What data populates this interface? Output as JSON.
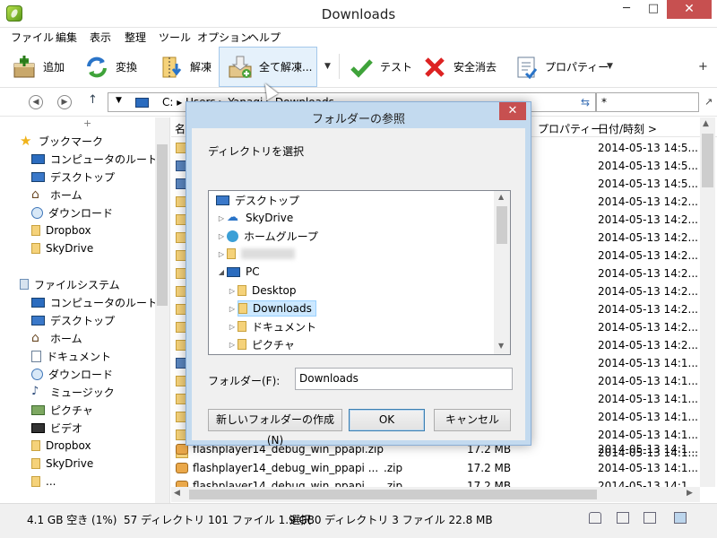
{
  "window": {
    "title": "Downloads",
    "minimize": "─",
    "maximize": "□",
    "close": "✕"
  },
  "menu": [
    "ファイル",
    "編集",
    "表示",
    "整理",
    "ツール",
    "オプション",
    "ヘルプ"
  ],
  "toolbar": {
    "add": "追加",
    "convert": "変換",
    "extract": "解凍",
    "extract_all": "全て解凍...",
    "test": "テスト",
    "secure_delete": "安全消去",
    "properties": "プロパティー"
  },
  "address": {
    "path": "C: ▸ Users ▸ Yanagi ▸ Downloads",
    "filter": "*"
  },
  "tree": {
    "bookmarks_title": "ブックマーク",
    "bookmarks": [
      {
        "label": "コンピュータのルート",
        "icon": "computer-icon"
      },
      {
        "label": "デスクトップ",
        "icon": "desktop-icon"
      },
      {
        "label": "ホーム",
        "icon": "home-icon"
      },
      {
        "label": "ダウンロード",
        "icon": "download-icon"
      },
      {
        "label": "Dropbox",
        "icon": "folder-icon"
      },
      {
        "label": "SkyDrive",
        "icon": "folder-icon"
      }
    ],
    "fs_title": "ファイルシステム",
    "filesystem": [
      {
        "label": "コンピュータのルート",
        "icon": "computer-icon"
      },
      {
        "label": "デスクトップ",
        "icon": "desktop-icon"
      },
      {
        "label": "ホーム",
        "icon": "home-icon"
      },
      {
        "label": "ドキュメント",
        "icon": "document-icon"
      },
      {
        "label": "ダウンロード",
        "icon": "download-icon"
      },
      {
        "label": "ミュージック",
        "icon": "music-icon"
      },
      {
        "label": "ピクチャ",
        "icon": "picture-icon"
      },
      {
        "label": "ビデオ",
        "icon": "video-icon"
      },
      {
        "label": "Dropbox",
        "icon": "folder-icon"
      },
      {
        "label": "SkyDrive",
        "icon": "folder-icon"
      },
      {
        "label": "...",
        "icon": "folder-icon"
      }
    ]
  },
  "filelist": {
    "headers": {
      "name": "名",
      "properties": "プロパティー",
      "date": "日付/時刻 >"
    },
    "dates": [
      "2014-05-13 14:5...",
      "2014-05-13 14:5...",
      "2014-05-13 14:5...",
      "2014-05-13 14:2...",
      "2014-05-13 14:2...",
      "2014-05-13 14:2...",
      "2014-05-13 14:2...",
      "2014-05-13 14:2...",
      "2014-05-13 14:2...",
      "2014-05-13 14:2...",
      "2014-05-13 14:2...",
      "2014-05-13 14:2...",
      "2014-05-13 14:1...",
      "2014-05-13 14:1...",
      "2014-05-13 14:1...",
      "2014-05-13 14:1...",
      "2014-05-13 14:1...",
      "2014-05-13 14:1..."
    ],
    "visible_rows": [
      {
        "name": "flashplayer14_debug_win_ppapi.zip",
        "ext": ".zip",
        "size": "17.2 MB",
        "date": "2014-05-13 14:1..."
      },
      {
        "name": "flashplayer14_debug_win_ppapi ...",
        "ext": ".zip",
        "size": "17.2 MB",
        "date": "2014-05-13 14:1..."
      },
      {
        "name": "flashplayer14_debug_win_ppapi...",
        "ext": ".zip",
        "size": "17.2 MB",
        "date": "2014-05-13 14:1..."
      }
    ]
  },
  "status": {
    "free": "4.1 GB 空き (1%)",
    "summary": "57 ディレクトリ 101 ファイル 1.9 GB",
    "selection": "選択 0 ディレクトリ 3 ファイル 22.8 MB"
  },
  "dialog": {
    "title": "フォルダーの参照",
    "close": "✕",
    "description": "ディレクトリを選択",
    "tree": [
      {
        "label": "デスクトップ",
        "icon": "desktop-icon",
        "indent": 0,
        "exp": ""
      },
      {
        "label": "SkyDrive",
        "icon": "cloud-icon",
        "indent": 1,
        "exp": "▷"
      },
      {
        "label": "ホームグループ",
        "icon": "homegroup-icon",
        "indent": 1,
        "exp": "▷"
      },
      {
        "label": "",
        "icon": "user-icon",
        "indent": 1,
        "exp": "▷"
      },
      {
        "label": "PC",
        "icon": "computer-icon",
        "indent": 1,
        "exp": "◢"
      },
      {
        "label": "Desktop",
        "icon": "folder-icon",
        "indent": 2,
        "exp": "▷"
      },
      {
        "label": "Downloads",
        "icon": "folder-download-icon",
        "indent": 2,
        "exp": "▷",
        "selected": true
      },
      {
        "label": "ドキュメント",
        "icon": "folder-icon",
        "indent": 2,
        "exp": "▷"
      },
      {
        "label": "ピクチャ",
        "icon": "folder-icon",
        "indent": 2,
        "exp": "▷"
      }
    ],
    "folder_label": "フォルダー(F):",
    "folder_value": "Downloads",
    "new_folder": "新しいフォルダーの作成(N)",
    "ok": "OK",
    "cancel": "キャンセル"
  }
}
